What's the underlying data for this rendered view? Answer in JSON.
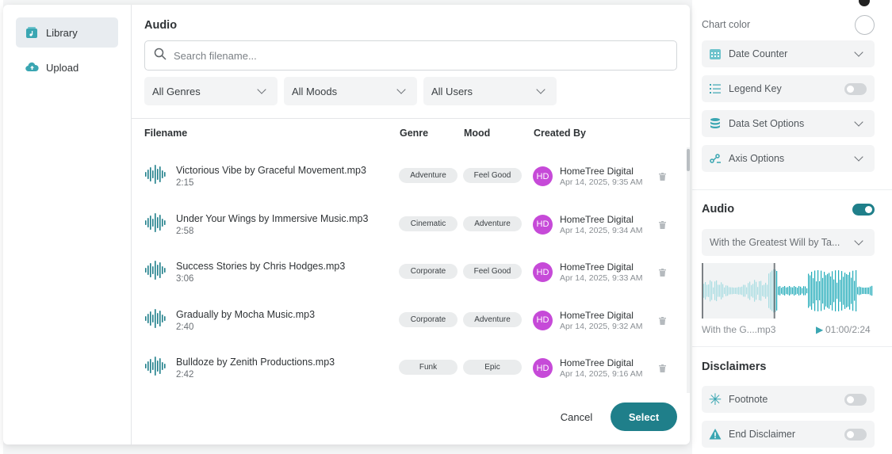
{
  "colors": {
    "accent": "#1f7f8a",
    "avatar": "#c64ad8",
    "pill": "#eaeced"
  },
  "modal": {
    "sidebar": {
      "items": [
        {
          "label": "Library",
          "icon": "library-icon",
          "active": true
        },
        {
          "label": "Upload",
          "icon": "cloud-upload-icon",
          "active": false
        }
      ]
    },
    "title": "Audio",
    "search": {
      "placeholder": "Search filename...",
      "value": ""
    },
    "filters": [
      {
        "label": "All Genres"
      },
      {
        "label": "All Moods"
      },
      {
        "label": "All Users"
      }
    ],
    "columns": {
      "filename": "Filename",
      "genre": "Genre",
      "mood": "Mood",
      "created_by": "Created By"
    },
    "rows": [
      {
        "filename": "Victorious Vibe by Graceful Movement.mp3",
        "duration": "2:15",
        "genre": "Adventure",
        "mood": "Feel Good",
        "initials": "HD",
        "creator": "HomeTree Digital",
        "date": "Apr 14, 2025, 9:35 AM"
      },
      {
        "filename": "Under Your Wings by Immersive Music.mp3",
        "duration": "2:58",
        "genre": "Cinematic",
        "mood": "Adventure",
        "initials": "HD",
        "creator": "HomeTree Digital",
        "date": "Apr 14, 2025, 9:34 AM"
      },
      {
        "filename": "Success Stories by Chris Hodges.mp3",
        "duration": "3:06",
        "genre": "Corporate",
        "mood": "Feel Good",
        "initials": "HD",
        "creator": "HomeTree Digital",
        "date": "Apr 14, 2025, 9:33 AM"
      },
      {
        "filename": "Gradually by Mocha Music.mp3",
        "duration": "2:40",
        "genre": "Corporate",
        "mood": "Adventure",
        "initials": "HD",
        "creator": "HomeTree Digital",
        "date": "Apr 14, 2025, 9:32 AM"
      },
      {
        "filename": "Bulldoze by Zenith Productions.mp3",
        "duration": "2:42",
        "genre": "Funk",
        "mood": "Epic",
        "initials": "HD",
        "creator": "HomeTree Digital",
        "date": "Apr 14, 2025, 9:16 AM"
      }
    ],
    "buttons": {
      "cancel": "Cancel",
      "select": "Select"
    }
  },
  "right_panel": {
    "chart_color_label": "Chart color",
    "items": [
      {
        "label": "Date Counter",
        "icon": "calendar-icon",
        "control": "chevron"
      },
      {
        "label": "Legend Key",
        "icon": "list-icon",
        "control": "toggle",
        "on": false
      },
      {
        "label": "Data Set Options",
        "icon": "database-icon",
        "control": "chevron"
      },
      {
        "label": "Axis Options",
        "icon": "axis-icon",
        "control": "chevron"
      }
    ],
    "audio": {
      "title": "Audio",
      "enabled": true,
      "selected_track": "With the Greatest Will by Ta...",
      "file_short": "With the G....mp3",
      "time": "01:00/2:24",
      "progress": 0.42
    },
    "disclaimers": {
      "title": "Disclaimers",
      "items": [
        {
          "label": "Footnote",
          "icon": "asterisk-icon",
          "on": false
        },
        {
          "label": "End Disclaimer",
          "icon": "warning-icon",
          "on": false
        }
      ]
    }
  }
}
